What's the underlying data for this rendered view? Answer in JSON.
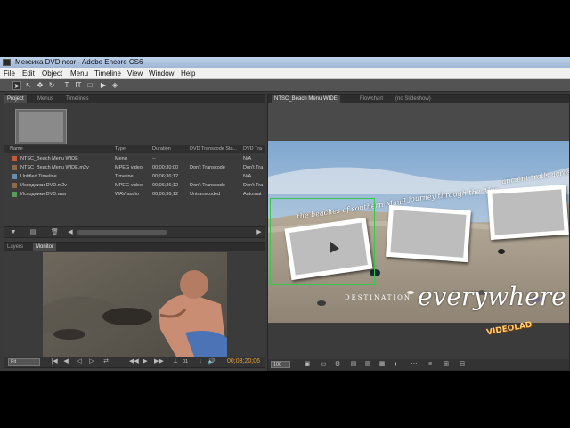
{
  "window": {
    "title": "Мексика DVD.ncor - Adobe Encore CS6"
  },
  "menubar": [
    "File",
    "Edit",
    "Object",
    "Menu",
    "Timeline",
    "View",
    "Window",
    "Help"
  ],
  "toolbar": {
    "tools": [
      "selection-tool",
      "direct-select-tool",
      "move-tool",
      "rotate-tool",
      "text-tool",
      "vertical-text-tool",
      "rectangle-tool",
      "preview-tool",
      "edit-in-photoshop-tool"
    ]
  },
  "project_panel": {
    "tabs": [
      "Project",
      "Menus",
      "Timelines"
    ],
    "columns": [
      "Name",
      "Type",
      "Duration",
      "DVD Transcode Sta...",
      "DVD Tra"
    ],
    "rows": [
      {
        "name": "NTSC_Beach Menu WIDE",
        "type": "Menu",
        "duration": "--",
        "transcode": "",
        "dvd": "N/A"
      },
      {
        "name": "NTSC_Beach Menu WIDE.m2v",
        "type": "MPEG video",
        "duration": "00;00;30;00",
        "transcode": "Don't Transcode",
        "dvd": "Don't Tra"
      },
      {
        "name": "Untitled Timeline",
        "type": "Timeline",
        "duration": "00;06;36;12",
        "transcode": "",
        "dvd": "N/A"
      },
      {
        "name": "Исходники DVD.m2v",
        "type": "MPEG video",
        "duration": "00;06;36;12",
        "transcode": "Don't Transcode",
        "dvd": "Don't Tra"
      },
      {
        "name": "Исходники DVD.wav",
        "type": "WAV audio",
        "duration": "00;06;36;12",
        "transcode": "Untranscoded",
        "dvd": "Automat"
      }
    ]
  },
  "monitor_panel": {
    "tabs": [
      "Layers",
      "Monitor"
    ],
    "zoom": "Fit",
    "timecode": "00;03;20;06",
    "fields": [
      "00",
      "01"
    ]
  },
  "editor_panel": {
    "tabs": [
      "NTSC_Beach Menu WIDE",
      "Flowchart",
      "(no Slideshow)"
    ],
    "menu_texts": {
      "beaches": "the beaches of southern Maui",
      "alps": "a journey through the Alps",
      "peru": "ancient trails across Peru",
      "destination": "DESTINATION",
      "everywhere": "everywhere"
    },
    "zoom": "100"
  },
  "watermark": "VIDEOLAD",
  "colors": {
    "timecode": "#e8a33a",
    "selection": "#35c84a",
    "panel": "#3b3b3b"
  }
}
